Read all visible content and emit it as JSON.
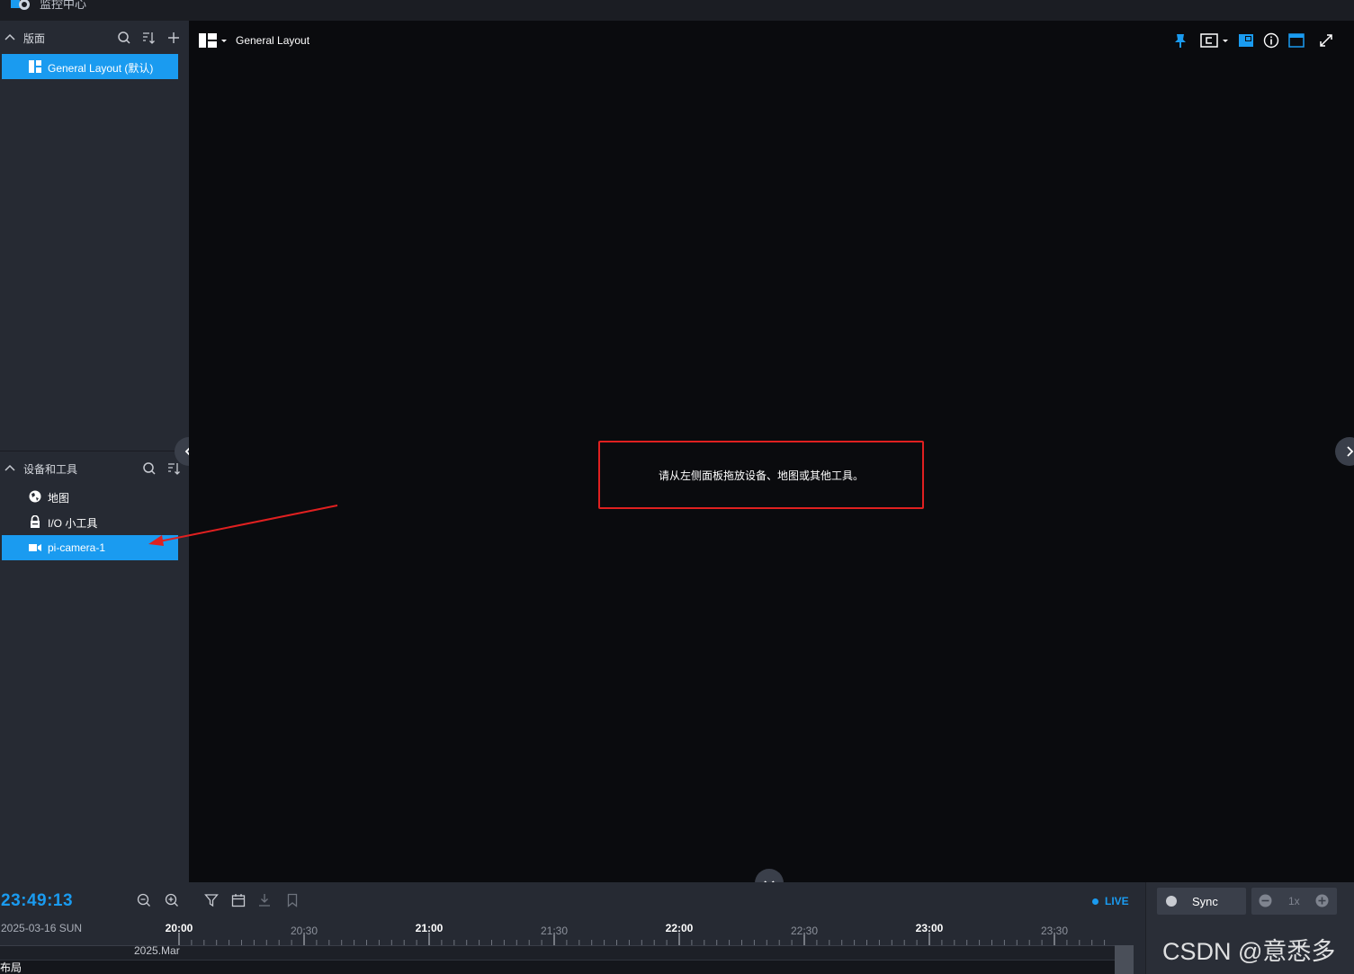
{
  "app": {
    "title": "监控中心"
  },
  "sidebar": {
    "layouts_section": {
      "title": "版面",
      "items": [
        {
          "label": "General Layout (默认)",
          "selected": true
        }
      ]
    },
    "devices_section": {
      "title": "设备和工具",
      "items": [
        {
          "label": "地图",
          "icon": "globe-icon",
          "selected": false
        },
        {
          "label": "I/O 小工具",
          "icon": "lock-icon",
          "selected": false
        },
        {
          "label": "pi-camera-1",
          "icon": "camera-icon",
          "selected": true
        }
      ]
    }
  },
  "main": {
    "layout_title": "General Layout",
    "hint": "请从左侧面板拖放设备、地图或其他工具。"
  },
  "timeline": {
    "clock": "23:49:13",
    "date": "2025-03-16 SUN",
    "live_label": "LIVE",
    "month_label": "2025.Mar",
    "row_label": "布局",
    "ticks": [
      {
        "label": "20:00",
        "major": true
      },
      {
        "label": "20:30",
        "major": false
      },
      {
        "label": "21:00",
        "major": true
      },
      {
        "label": "21:30",
        "major": false
      },
      {
        "label": "22:00",
        "major": true
      },
      {
        "label": "22:30",
        "major": false
      },
      {
        "label": "23:00",
        "major": true
      },
      {
        "label": "23:30",
        "major": false
      }
    ],
    "sync_label": "Sync",
    "speed_label": "1x"
  },
  "watermark": "CSDN @意悉多",
  "colors": {
    "accent": "#1a9bf0",
    "highlight_box": "#e02020",
    "sidebar_bg": "#262a33",
    "main_bg": "#0a0b0e"
  }
}
